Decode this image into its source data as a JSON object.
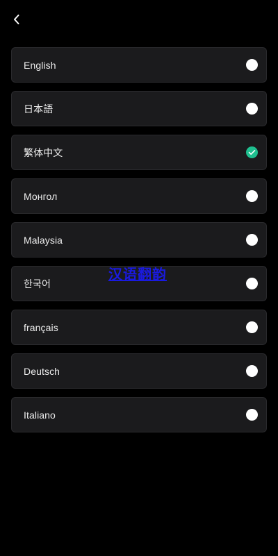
{
  "header": {
    "back_icon": "chevron-left-icon"
  },
  "languages": [
    {
      "label": "English",
      "selected": false
    },
    {
      "label": "日本語",
      "selected": false
    },
    {
      "label": "繁体中文",
      "selected": true
    },
    {
      "label": "Монгол",
      "selected": false
    },
    {
      "label": "Malaysia",
      "selected": false
    },
    {
      "label": "한국어",
      "selected": false
    },
    {
      "label": "français",
      "selected": false
    },
    {
      "label": "Deutsch",
      "selected": false
    },
    {
      "label": "Italiano",
      "selected": false
    }
  ],
  "overlay": {
    "text": "汉语翻韵"
  },
  "colors": {
    "background": "#000000",
    "item_background": "#1b1b1d",
    "selected_accent": "#1fbf8f",
    "radio_unselected": "#ffffff",
    "overlay_text": "#1a1ae0"
  }
}
